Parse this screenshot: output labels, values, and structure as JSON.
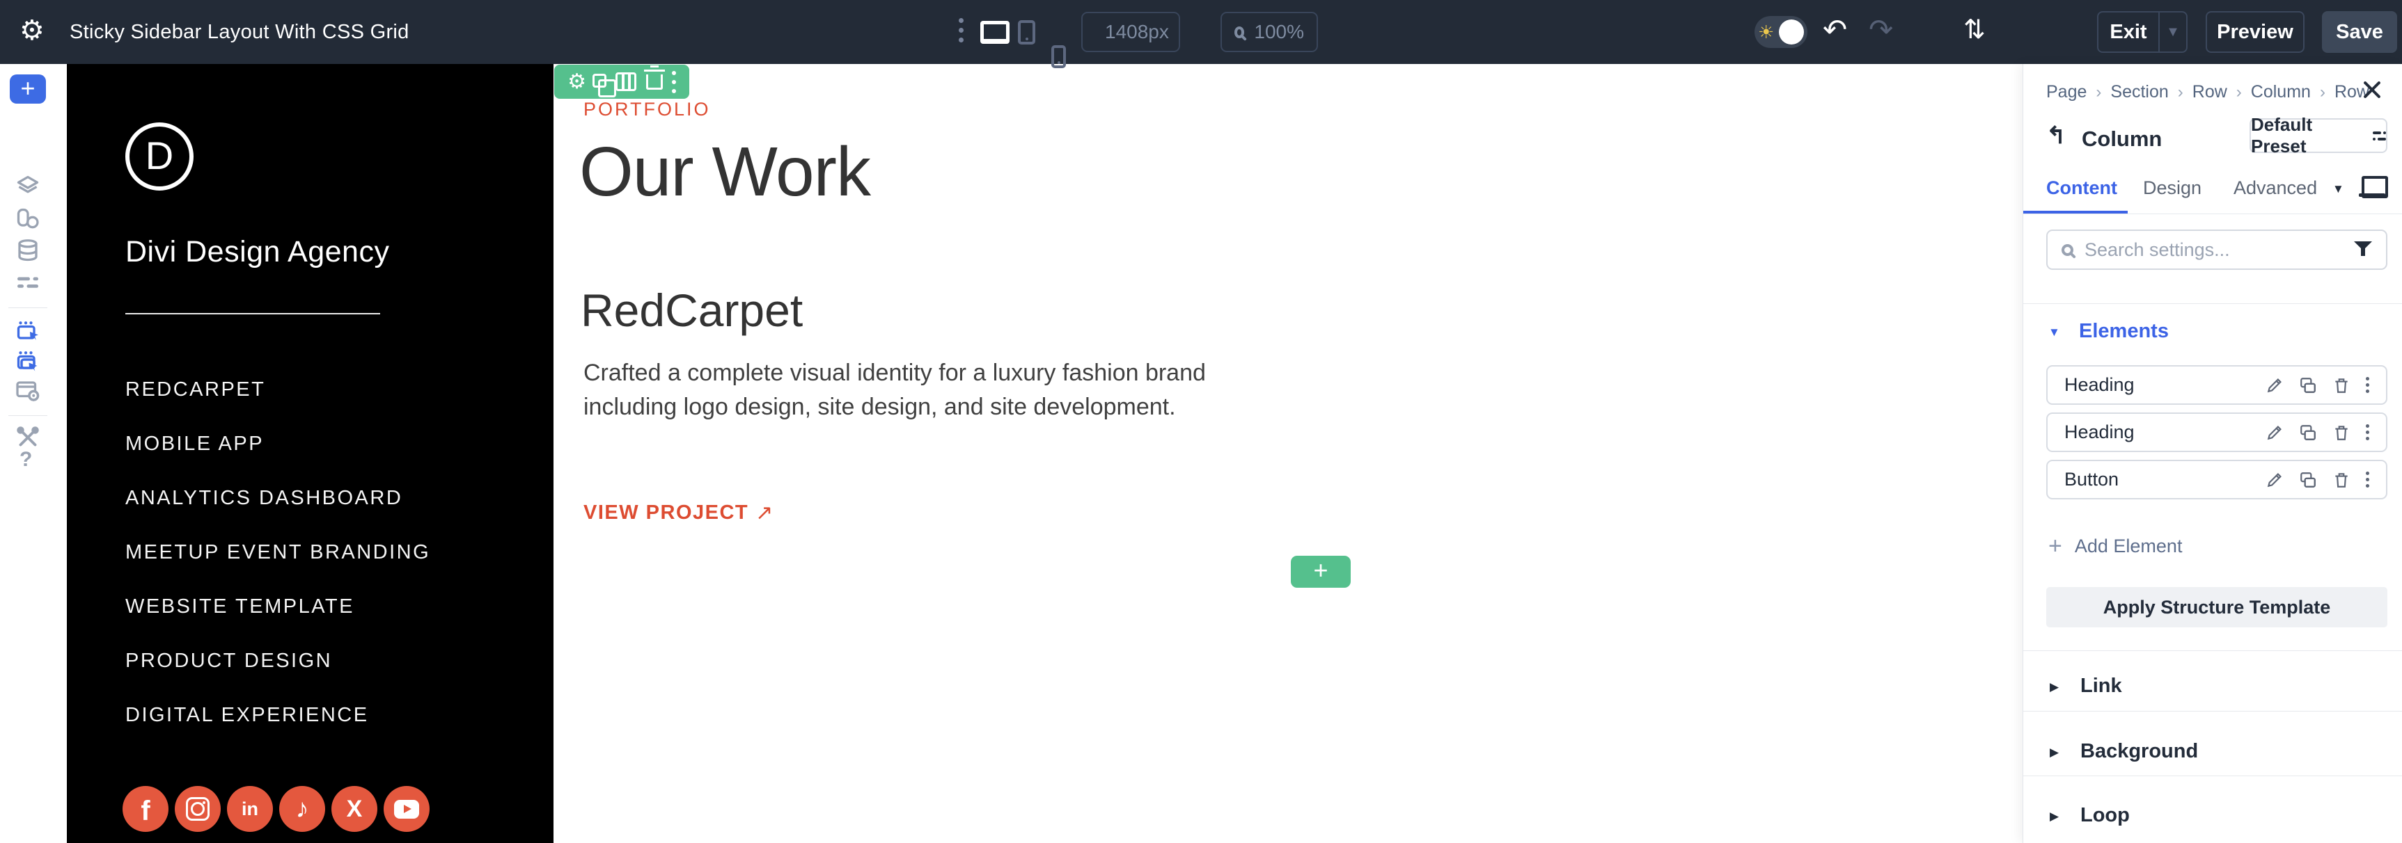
{
  "topbar": {
    "title": "Sticky Sidebar Layout With CSS Grid",
    "width_value": "1408px",
    "zoom_value": "100%",
    "exit_label": "Exit",
    "preview_label": "Preview",
    "save_label": "Save"
  },
  "rail": {
    "help_label": "?"
  },
  "sidebar": {
    "logo_letter": "D",
    "brand": "Divi Design Agency",
    "menu": [
      "REDCARPET",
      "MOBILE APP",
      "ANALYTICS DASHBOARD",
      "MEETUP EVENT BRANDING",
      "WEBSITE TEMPLATE",
      "PRODUCT DESIGN",
      "DIGITAL EXPERIENCE"
    ],
    "social": [
      "facebook",
      "instagram",
      "linkedin",
      "tiktok",
      "x",
      "youtube"
    ]
  },
  "content": {
    "eyebrow": "PORTFOLIO",
    "title": "Our Work",
    "project_title": "RedCarpet",
    "project_description": "Crafted a complete visual identity for a luxury fashion brand including logo design, site design, and site development.",
    "cta_label": "VIEW PROJECT",
    "cta_arrow": "↗"
  },
  "panel": {
    "breadcrumb": [
      "Page",
      "Section",
      "Row",
      "Column",
      "Row"
    ],
    "title": "Column",
    "preset_label": "Default Preset",
    "tabs": [
      "Content",
      "Design",
      "Advanced"
    ],
    "active_tab": "Content",
    "search_placeholder": "Search settings...",
    "elements_header": "Elements",
    "elements": [
      "Heading",
      "Heading",
      "Button"
    ],
    "add_element_label": "Add Element",
    "apply_template_label": "Apply Structure Template",
    "sections": [
      "Link",
      "Background",
      "Loop"
    ]
  },
  "colors": {
    "accent_red": "#DD4C31",
    "accent_green": "#55C08D",
    "accent_blue": "#3C63E6",
    "topbar_bg": "#232B37",
    "social_red": "#E4583E",
    "sidebar_bg": "#000000"
  }
}
